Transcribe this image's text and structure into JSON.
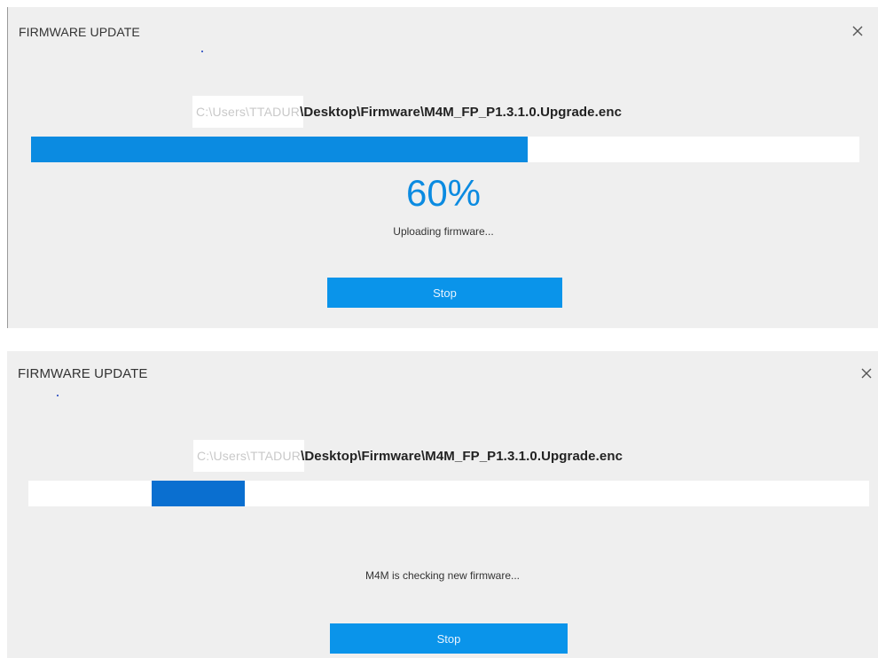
{
  "dialogs": [
    {
      "title": "FIRMWARE UPDATE",
      "path_masked": "C:\\Users\\TTADUR",
      "path_visible": "\\Desktop\\Firmware\\M4M_FP_P1.3.1.0.Upgrade.enc",
      "progress_fraction": 0.6,
      "percent_label": "60%",
      "status": "Uploading firmware...",
      "stop_label": "Stop",
      "icons": {
        "close": "close-icon"
      }
    },
    {
      "title": "FIRMWARE UPDATE",
      "path_masked": "C:\\Users\\TTADUR",
      "path_visible": "\\Desktop\\Firmware\\M4M_FP_P1.3.1.0.Upgrade.enc",
      "progress_indeterminate": true,
      "status": "M4M is checking new firmware...",
      "stop_label": "Stop",
      "icons": {
        "close": "close-icon"
      }
    }
  ],
  "colors": {
    "accent": "#0b8be1",
    "indeterminate_fill": "#0a6fd0",
    "dialog_bg": "#efefef",
    "button": "#0a94ea"
  }
}
